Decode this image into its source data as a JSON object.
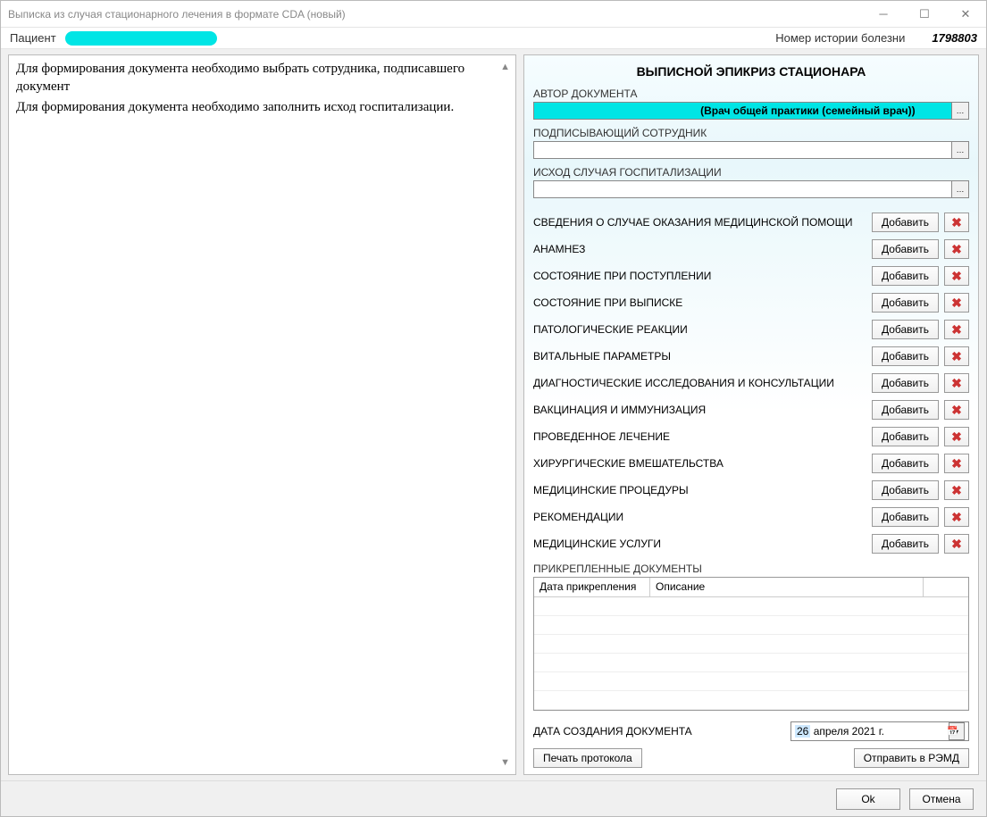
{
  "window": {
    "title": "Выписка из случая стационарного лечения в формате CDA (новый)"
  },
  "info": {
    "patient_label": "Пациент",
    "history_label": "Номер истории болезни",
    "history_number": "1798803"
  },
  "left_messages": [
    "Для формирования документа необходимо выбрать сотрудника, подписавшего документ",
    "Для формирования документа необходимо заполнить исход госпитализации."
  ],
  "form": {
    "title": "ВЫПИСНОЙ ЭПИКРИЗ СТАЦИОНАРА",
    "author_label": "АВТОР ДОКУМЕНТА",
    "author_value": "(Врач общей практики (семейный врач))",
    "signer_label": "ПОДПИСЫВАЮЩИЙ СОТРУДНИК",
    "signer_value": "",
    "outcome_label": "ИСХОД СЛУЧАЯ ГОСПИТАЛИЗАЦИИ",
    "outcome_value": "",
    "add_button": "Добавить",
    "sections": [
      "СВЕДЕНИЯ О СЛУЧАЕ ОКАЗАНИЯ МЕДИЦИНСКОЙ ПОМОЩИ",
      "АНАМНЕЗ",
      "СОСТОЯНИЕ ПРИ ПОСТУПЛЕНИИ",
      "СОСТОЯНИЕ ПРИ ВЫПИСКЕ",
      "ПАТОЛОГИЧЕСКИЕ РЕАКЦИИ",
      "ВИТАЛЬНЫЕ ПАРАМЕТРЫ",
      "ДИАГНОСТИЧЕСКИЕ ИССЛЕДОВАНИЯ И КОНСУЛЬТАЦИИ",
      "ВАКЦИНАЦИЯ И ИММУНИЗАЦИЯ",
      "ПРОВЕДЕННОЕ ЛЕЧЕНИЕ",
      "ХИРУРГИЧЕСКИЕ ВМЕШАТЕЛЬСТВА",
      "МЕДИЦИНСКИЕ ПРОЦЕДУРЫ",
      "РЕКОМЕНДАЦИИ",
      "МЕДИЦИНСКИЕ УСЛУГИ"
    ],
    "attachments_label": "ПРИКРЕПЛЕННЫЕ ДОКУМЕНТЫ",
    "attach_col_date": "Дата прикрепления",
    "attach_col_desc": "Описание",
    "doc_date_label": "ДАТА СОЗДАНИЯ ДОКУМЕНТА",
    "doc_date_day": "26",
    "doc_date_rest": "апреля   2021 г.",
    "print_button": "Печать протокола",
    "send_button": "Отправить в РЭМД"
  },
  "footer": {
    "ok": "Ok",
    "cancel": "Отмена"
  }
}
